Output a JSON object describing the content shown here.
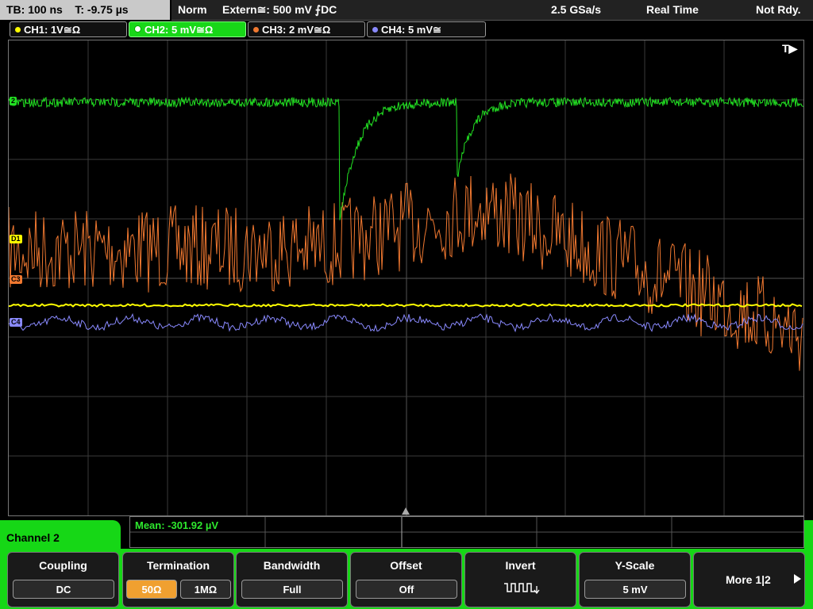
{
  "status": {
    "timebase": "TB: 100 ns",
    "trigger_time": "T: -9.75 µs",
    "mode": "Norm",
    "trigger": "Extern≅: 500 mV ⨍DC",
    "sample_rate": "2.5 GSa/s",
    "acq_mode": "Real Time",
    "state": "Not Rdy."
  },
  "channels": [
    {
      "label": "CH1: 1V≅Ω",
      "color": "#ffff00"
    },
    {
      "label": "CH2: 5 mV≅Ω",
      "color": "#22e022"
    },
    {
      "label": "CH3: 2 mV≅Ω",
      "color": "#f07830"
    },
    {
      "label": "CH4: 5 mV≅",
      "color": "#8a8aff"
    }
  ],
  "markers": {
    "trigger_flag": "T▶",
    "ch2": "2",
    "ch1": "D1",
    "ch3": "C3",
    "ch4": "C4"
  },
  "measurement": {
    "label": "Mean: -301.92 µV"
  },
  "menu": {
    "title": "Channel 2",
    "keys": [
      {
        "title": "Coupling",
        "values": [
          "DC"
        ]
      },
      {
        "title": "Termination",
        "values": [
          "50Ω",
          "1MΩ"
        ],
        "selected": 0
      },
      {
        "title": "Bandwidth",
        "values": [
          "Full"
        ]
      },
      {
        "title": "Offset",
        "values": [
          "Off"
        ]
      },
      {
        "title": "Invert",
        "icon": "invert-waveform-icon"
      },
      {
        "title": "Y-Scale",
        "values": [
          "5 mV"
        ]
      },
      {
        "title": "More 1|2",
        "icon": "play-arrow-icon"
      }
    ]
  }
}
